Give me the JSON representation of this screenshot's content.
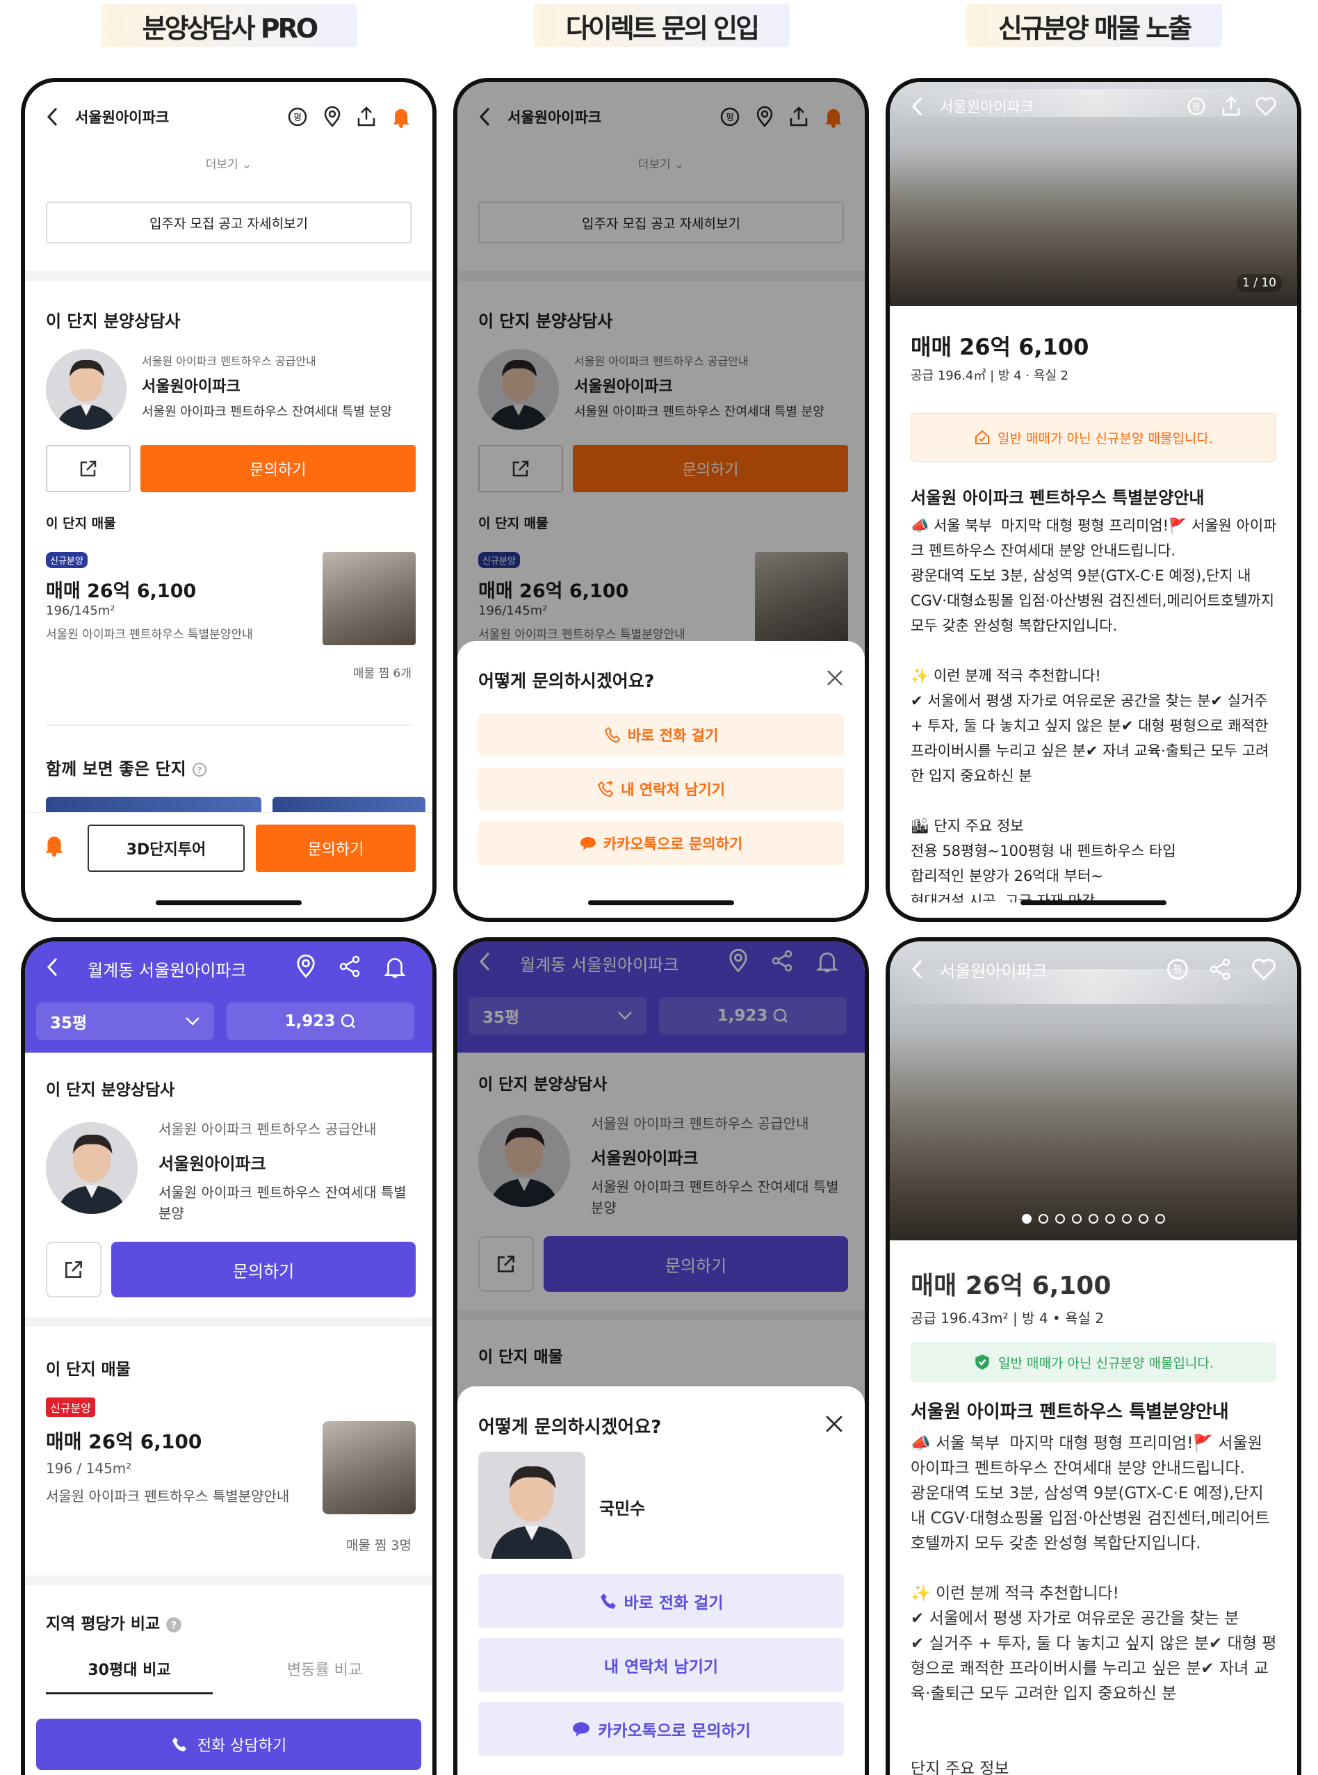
{
  "columns": [
    "분양상담사 PRO",
    "다이렉트 문의 인입",
    "신규분양 매물 노출"
  ],
  "p1": {
    "title": "서울원아이파크",
    "more": "더보기",
    "announcement_button": "입주자 모집  공고 자세히보기",
    "counselor_section": "이 단지 분양상담사",
    "counselor_sub": "서울원 아이파크 펜트하우스 공급안내",
    "counselor_name": "서울원아이파크",
    "counselor_desc": "서울원 아이파크 펜트하우스 잔여세대 특별 분양",
    "inquire": "문의하기",
    "listing_section": "이 단지 매물",
    "badge": "신규분양",
    "price": "매매 26억 6,100",
    "area": "196/145m²",
    "listing_desc": "서울원 아이파크 펜트하우스 특별분양안내",
    "saved": "매물 찜 6개",
    "together": "함께 보면 좋은 단지",
    "tour": "3D단지투어",
    "bottom_inquire": "문의하기"
  },
  "p2": {
    "sheet_title": "어떻게 문의하시겠어요?",
    "call": "바로 전화 걸기",
    "leave_contact": "내 연락처 남기기",
    "kakao": "카카오톡으로 문의하기"
  },
  "p3": {
    "counter": "1 / 10",
    "price": "매매 26억 6,100",
    "spec": "공급 196.4㎡  |  방 4 · 욕실 2",
    "notice": "일반 매매가 아닌 신규분양 매물입니다.",
    "heading": "서울원 아이파크 펜트하우스 특별분양안내",
    "desc": "📣 서울 북부  마지막 대형 평형 프리미엄!🚩 서울원 아이파크 펜트하우스 잔여세대 분양 안내드립니다.\n광운대역 도보 3분, 삼성역 9분(GTX-C·E 예정),단지 내 CGV·대형쇼핑몰 입점·아산병원 검진센터,메리어트호텔까지 모두 갖춘 완성형 복합단지입니다.\n\n✨ 이런 분께 적극 추천합니다!\n✔ 서울에서 평생 자가로 여유로운 공간을 찾는 분✔ 실거주 + 투자, 둘 다 놓치고 싶지 않은 분✔ 대형 평형으로 쾌적한 프라이버시를 누리고 싶은 분✔ 자녀 교육·출퇴근 모두 고려한 입지 중요하신 분\n\n🏙 단지 주요 정보\n전용 58평형~100평형 내 펜트하우스 타입\n합리적인 분양가 26억대 부터~\n현대건설 시공, 고급 자재 마감"
  },
  "p4": {
    "title": "월계동 서울원아이파크",
    "size": "35평",
    "count": "1,923",
    "counselor_section": "이 단지 분양상담사",
    "counselor_sub": "서울원 아이파크 펜트하우스 공급안내",
    "counselor_name": "서울원아이파크",
    "counselor_desc": "서울원 아이파크 펜트하우스 잔여세대 특별 분양",
    "inquire": "문의하기",
    "listing_section": "이 단지 매물",
    "badge": "신규분양",
    "price": "매매 26억 6,100",
    "area": "196 / 145m²",
    "listing_desc": "서울원 아이파크 펜트하우스 특별분양안내",
    "saved": "매물 찜 3명",
    "compare_section": "지역 평당가 비교",
    "tab1": "30평대 비교",
    "tab2": "변동률 비교",
    "call_counsel": "전화 상담하기"
  },
  "p5": {
    "sheet_title": "어떻게 문의하시겠어요?",
    "agent_name": "국민수",
    "call": "바로 전화 걸기",
    "leave_contact": "내 연락처 남기기",
    "kakao": "카카오톡으로 문의하기"
  },
  "p6": {
    "title": "서울원아이파크",
    "price": "매매 26억 6,100",
    "spec": "공급 196.43m²  |  방 4 • 욕실 2",
    "notice": "일반 매매가 아닌 신규분양 매물입니다.",
    "heading": "서울원 아이파크 펜트하우스 특별분양안내",
    "desc": "📣 서울 북부  마지막 대형 평형 프리미엄!🚩 서울원 아이파크 펜트하우스 잔여세대 분양 안내드립니다.\n광운대역 도보 3분, 삼성역 9분(GTX-C·E 예정),단지 내 CGV·대형쇼핑몰 입점·아산병원 검진센터,메리어트호텔까지 모두 갖춘 완성형 복합단지입니다.\n\n✨ 이런 분께 적극 추천합니다!\n✔ 서울에서 평생 자가로 여유로운 공간을 찾는 분\n✔ 실거주 + 투자, 둘 다 놓치고 싶지 않은 분✔ 대형 평형으로 쾌적한 프라이버시를 누리고 싶은 분✔ 자녀 교육·출퇴근 모두 고려한 입지 중요하신 분",
    "more_heading": "단지 주요 정보"
  },
  "colors": {
    "orange": "#ff6b0f",
    "purple": "#5b4de0",
    "green": "#2fa35a"
  },
  "icons": [
    "back-icon",
    "price-tag-icon",
    "location-pin-icon",
    "share-upload-icon",
    "bell-icon",
    "chevron-down-icon",
    "external-link-icon",
    "phone-icon",
    "phone-forward-icon",
    "chat-bubble-icon",
    "close-icon",
    "heart-icon",
    "share-icon",
    "house-check-icon",
    "shield-check-icon",
    "help-icon",
    "search-chat-icon"
  ]
}
